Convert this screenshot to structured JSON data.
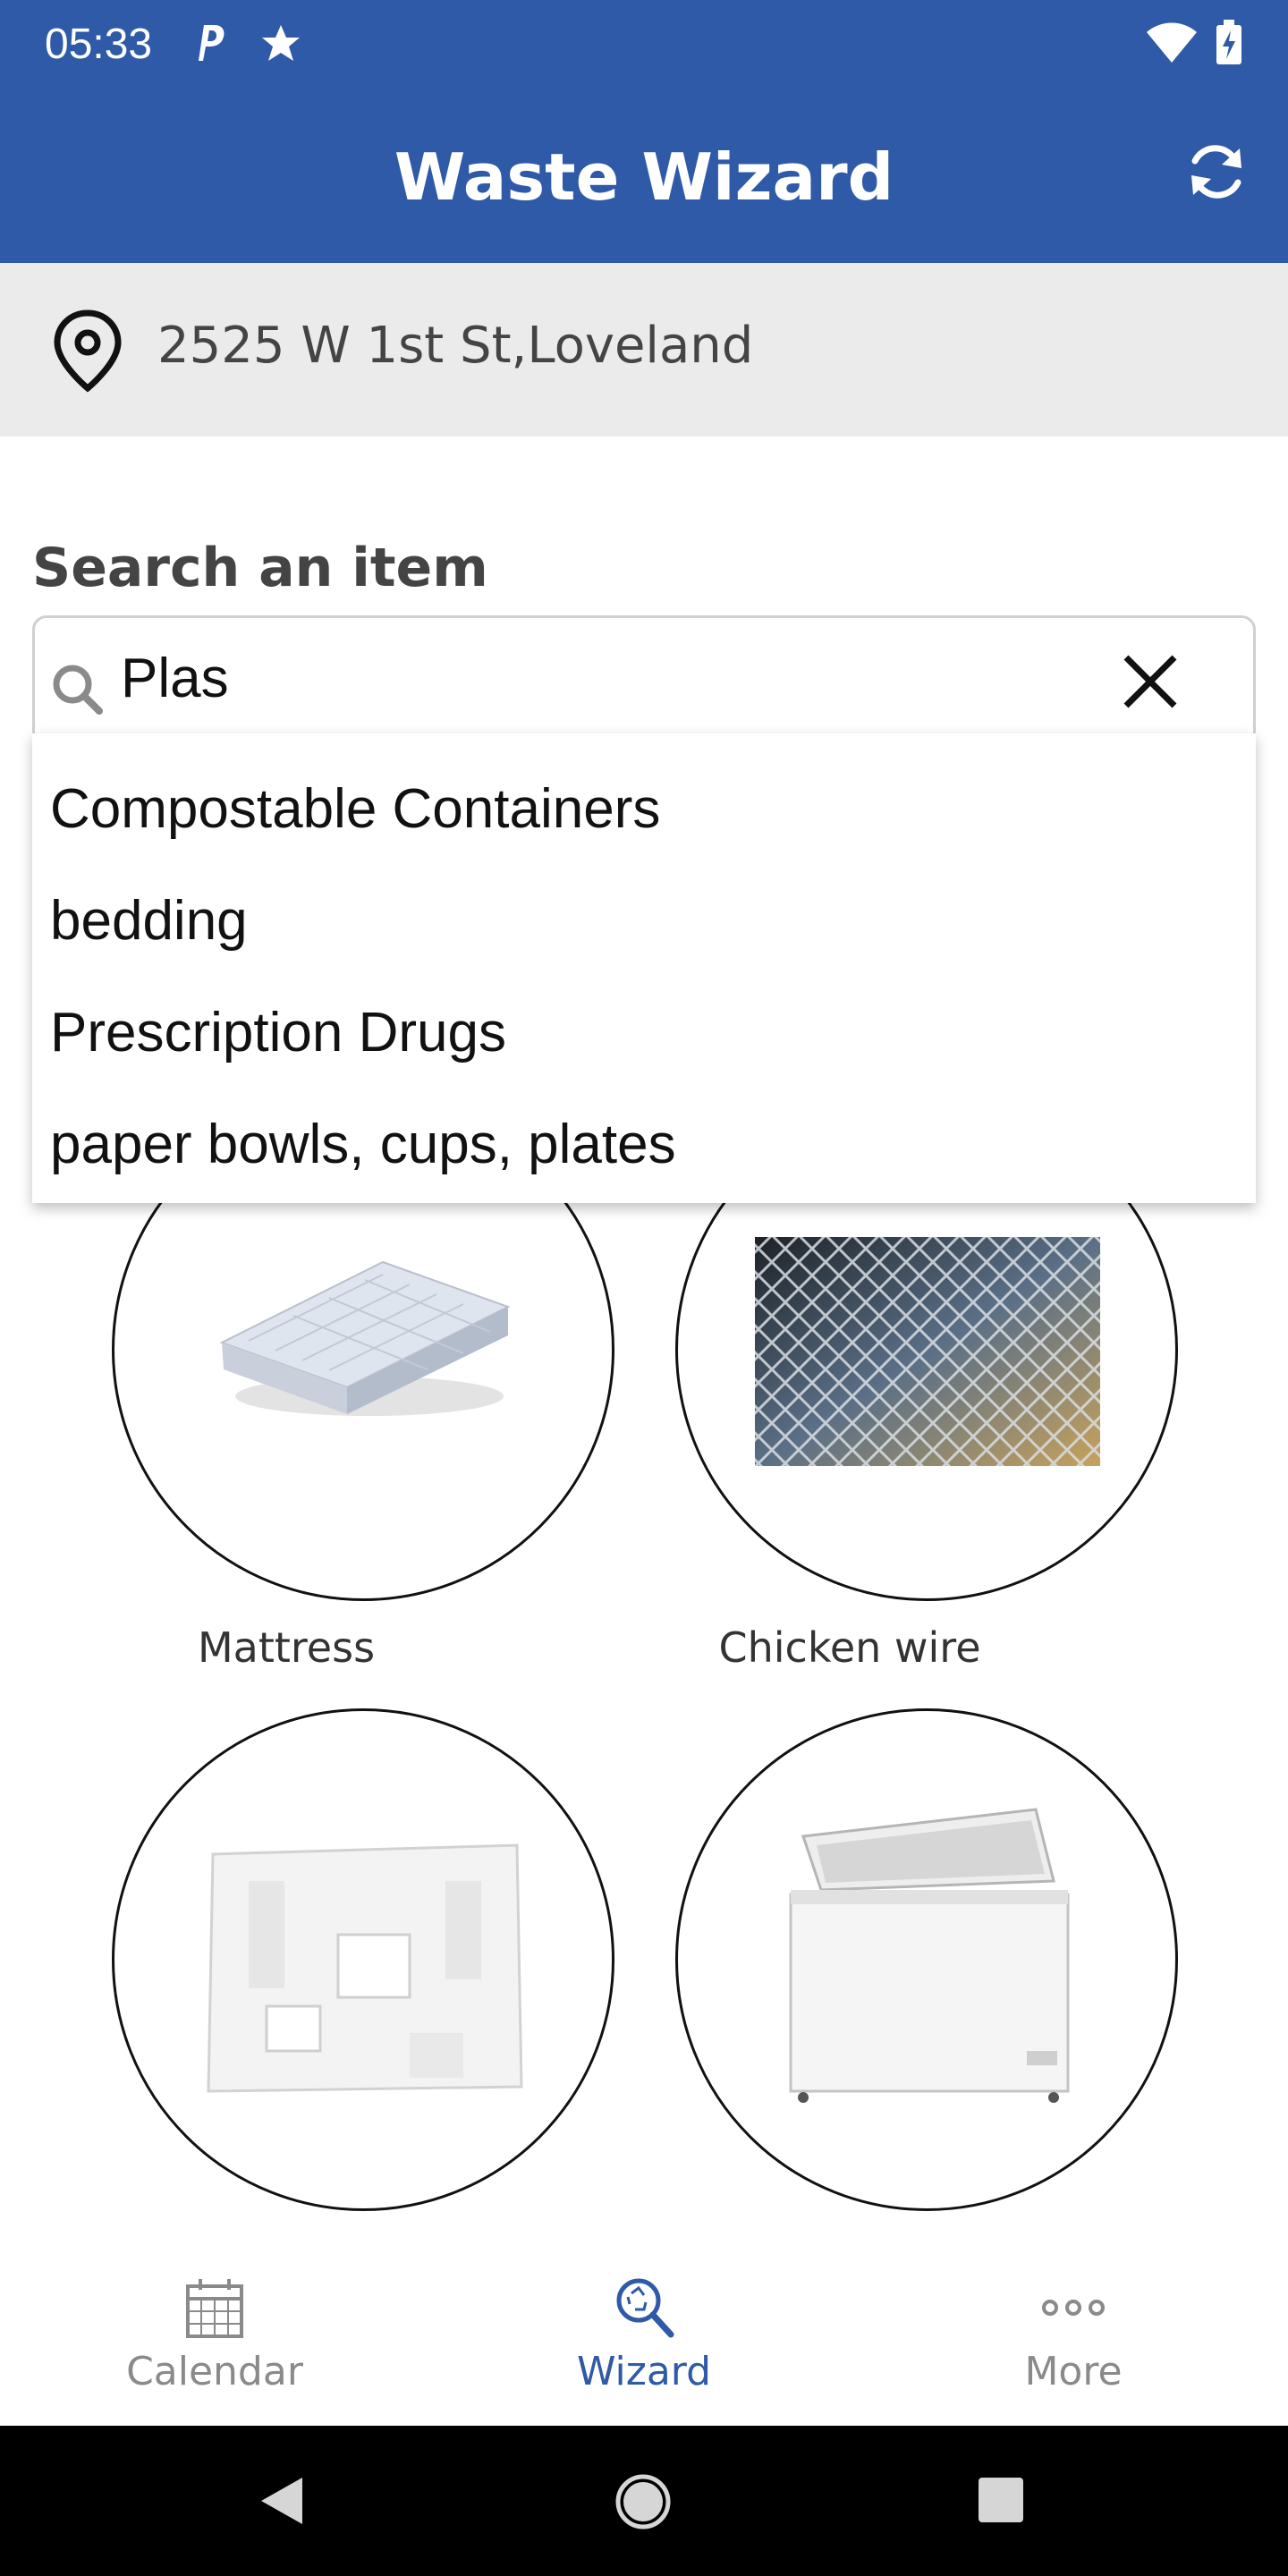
{
  "status_bar": {
    "time": "05:33"
  },
  "app_bar": {
    "title": "Waste Wizard"
  },
  "address": {
    "text": "2525 W 1st St,Loveland"
  },
  "search": {
    "label": "Search an item",
    "value": "Plas"
  },
  "suggestions": [
    "Compostable Containers",
    "bedding",
    "Prescription Drugs",
    "paper bowls, cups, plates"
  ],
  "items": [
    {
      "label": "Mattress"
    },
    {
      "label": "Chicken wire"
    },
    {
      "label": ""
    },
    {
      "label": ""
    }
  ],
  "bottom_nav": {
    "tabs": [
      {
        "label": "Calendar",
        "icon": "calendar-icon",
        "active": false
      },
      {
        "label": "Wizard",
        "icon": "wizard-search-icon",
        "active": true
      },
      {
        "label": "More",
        "icon": "more-icon",
        "active": false
      }
    ]
  },
  "colors": {
    "primary": "#2f5aa8",
    "address_bg": "#ebebeb",
    "inactive": "#8a8a8a"
  }
}
